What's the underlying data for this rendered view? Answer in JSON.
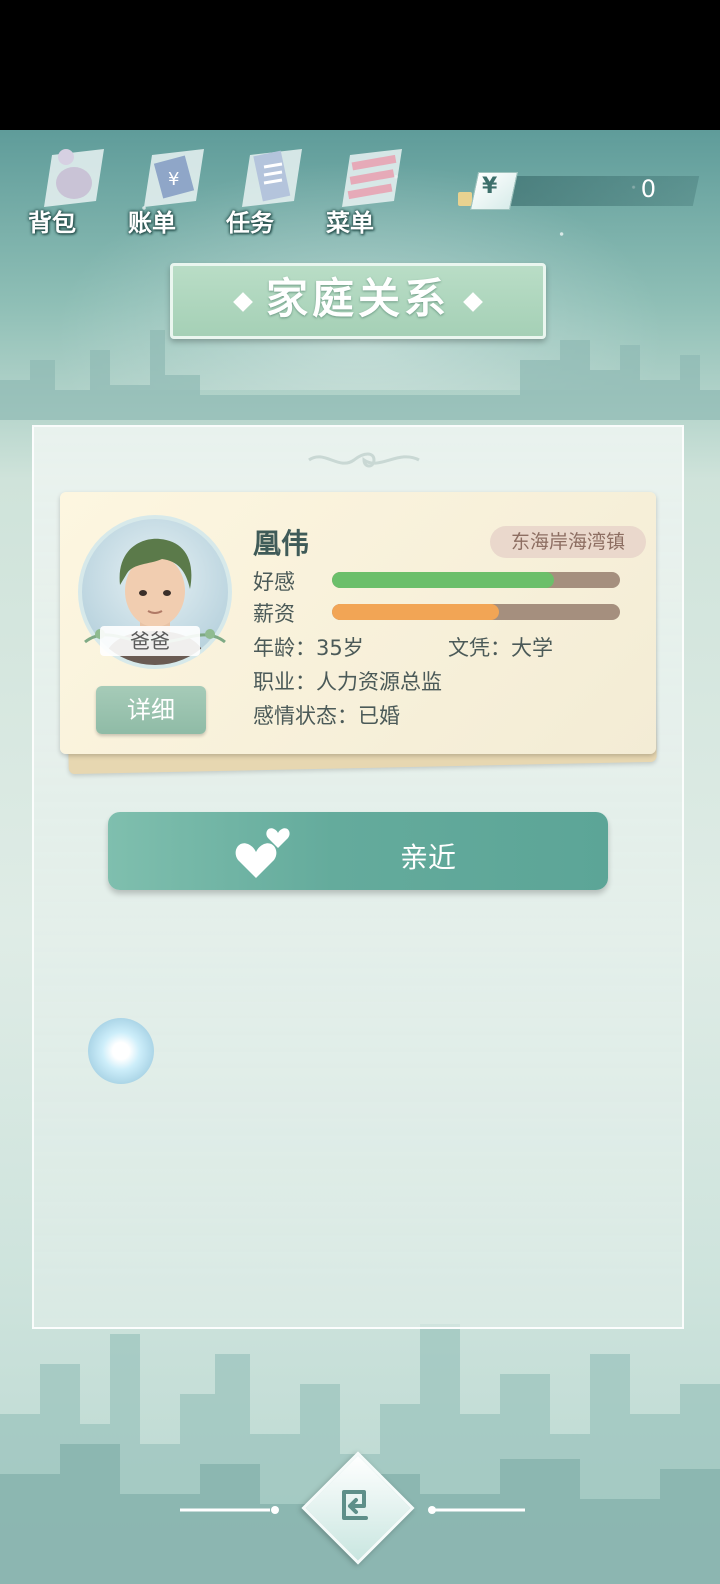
{
  "menu": {
    "items": [
      {
        "label": "背包",
        "icon": "backpack-icon"
      },
      {
        "label": "账单",
        "icon": "bill-icon"
      },
      {
        "label": "任务",
        "icon": "task-icon"
      },
      {
        "label": "菜单",
        "icon": "menu-icon"
      }
    ]
  },
  "currency": {
    "symbol": "¥",
    "value": "0"
  },
  "title": "家庭关系",
  "character": {
    "name": "凰伟",
    "location": "东海岸海湾镇",
    "role": "爸爸",
    "detail_label": "详细",
    "favor_label": "好感",
    "favor_value": 0.77,
    "salary_label": "薪资",
    "salary_value": 0.58,
    "age": "年龄：35岁",
    "education": "文凭：大学",
    "job": "职业：人力资源总监",
    "relationship": "感情状态：已婚"
  },
  "actions": {
    "approach_label": "亲近"
  },
  "colors": {
    "favor": "#6bbf6a",
    "salary": "#f2a555",
    "accent": "#64ab9c"
  }
}
